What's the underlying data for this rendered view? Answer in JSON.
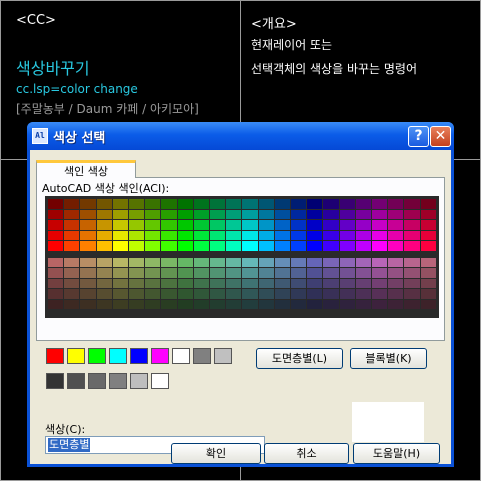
{
  "background": {
    "left": {
      "heading": "<CC>",
      "title": "색상바꾸기",
      "lisp": "cc.lsp=color change",
      "source": "[주말농부 / Daum 카페 / 아키모아]"
    },
    "right": {
      "heading": "<개요>",
      "line1": "현재레이어 또는",
      "line2": "선택객체의 색상을 바꾸는 명령어"
    }
  },
  "dialog": {
    "title": "색상 선택",
    "app_icon": "Al",
    "help_label": "?",
    "close_label": "✕",
    "tab_label": "색인 색상",
    "aci_label": "AutoCAD 색상 색인(ACI):",
    "bylayer_label": "도면층별(L)",
    "byblock_label": "블록별(K)",
    "color_label": "색상(C):",
    "color_value": "도면층별",
    "ok_label": "확인",
    "cancel_label": "취소",
    "help_button_label": "도움말(H)"
  },
  "standard_colors": [
    "#ff0000",
    "#ffff00",
    "#00ff00",
    "#00ffff",
    "#0000ff",
    "#ff00ff",
    "#ffffff",
    "#808080",
    "#c0c0c0"
  ],
  "gray_colors": [
    "#333333",
    "#505050",
    "#696969",
    "#808080",
    "#bebebe",
    "#ffffff"
  ]
}
